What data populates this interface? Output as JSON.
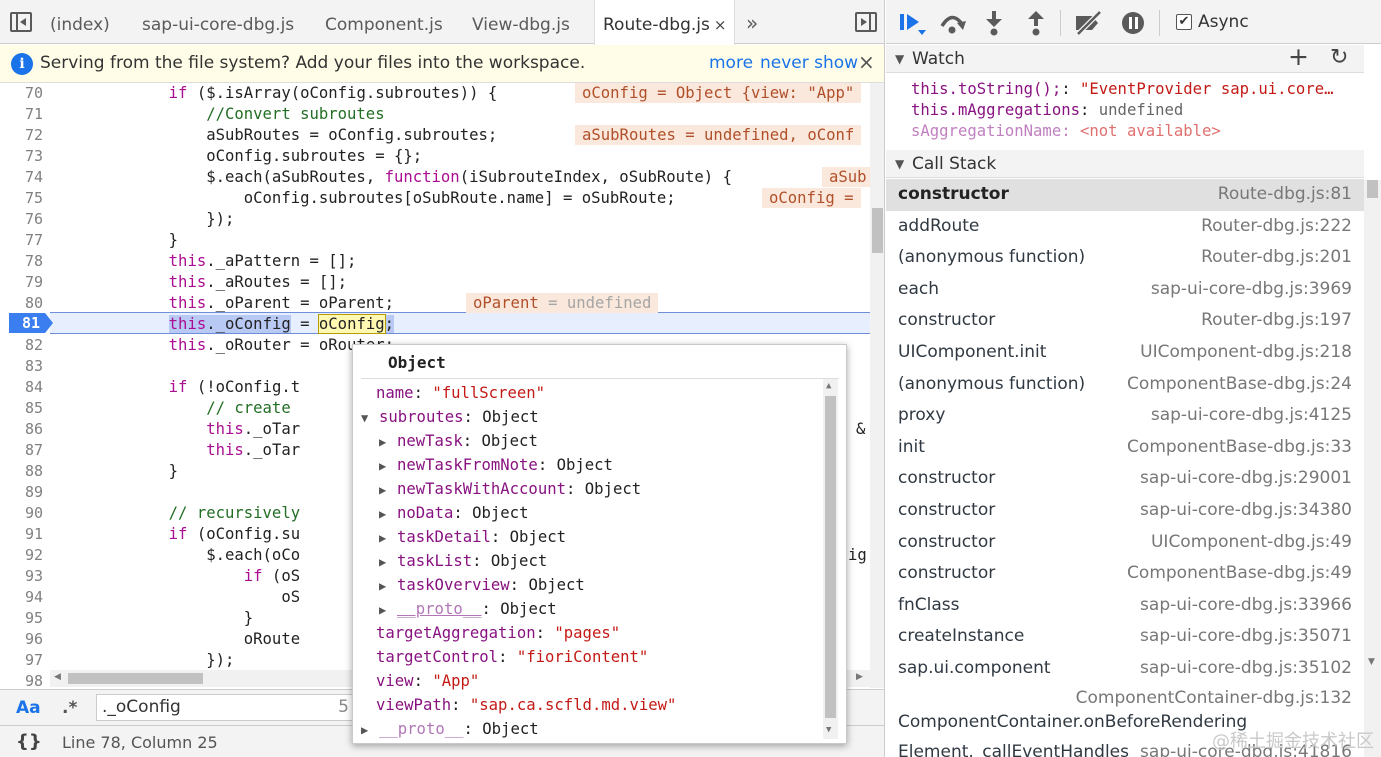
{
  "tabs": [
    {
      "label": "(index)"
    },
    {
      "label": "sap-ui-core-dbg.js"
    },
    {
      "label": "Component.js"
    },
    {
      "label": "View-dbg.js"
    },
    {
      "label": "Route-dbg.js",
      "close": "×"
    }
  ],
  "more_tabs": "»",
  "infobar": {
    "message": "Serving from the file system? Add your files into the workspace.",
    "more": "more",
    "never_show": "never show",
    "close": "×",
    "icon": "i"
  },
  "code": {
    "lines": [
      {
        "n": "70",
        "t": "            if ($.isArray(oConfig.subroutes)) {"
      },
      {
        "n": "71",
        "t": "                //Convert subroutes"
      },
      {
        "n": "72",
        "t": "                aSubRoutes = oConfig.subroutes;"
      },
      {
        "n": "73",
        "t": "                oConfig.subroutes = {};"
      },
      {
        "n": "74",
        "t": "                $.each(aSubRoutes, function(iSubrouteIndex, oSubRoute) {"
      },
      {
        "n": "75",
        "t": "                    oConfig.subroutes[oSubRoute.name] = oSubRoute;"
      },
      {
        "n": "76",
        "t": "                });"
      },
      {
        "n": "77",
        "t": "            }"
      },
      {
        "n": "78",
        "t": "            this._aPattern = [];"
      },
      {
        "n": "79",
        "t": "            this._aRoutes = [];"
      },
      {
        "n": "80",
        "t": "            this._oParent = oParent;"
      },
      {
        "n": "81",
        "t": ""
      },
      {
        "n": "82",
        "t": "            this._oRouter = oRouter;"
      },
      {
        "n": "83",
        "t": ""
      },
      {
        "n": "84",
        "t": "            if (!oConfig.t"
      },
      {
        "n": "85",
        "t": "                // create"
      },
      {
        "n": "86",
        "t": "                this._oTar"
      },
      {
        "n": "87",
        "t": "                this._oTar"
      },
      {
        "n": "88",
        "t": "            }"
      },
      {
        "n": "89",
        "t": ""
      },
      {
        "n": "90",
        "t": "            // recursively"
      },
      {
        "n": "91",
        "t": "            if (oConfig.su"
      },
      {
        "n": "92",
        "t": "                $.each(oCo"
      },
      {
        "n": "93",
        "t": "                    if (oS"
      },
      {
        "n": "94",
        "t": "                        oS"
      },
      {
        "n": "95",
        "t": "                    }"
      },
      {
        "n": "96",
        "t": "                    oRoute"
      },
      {
        "n": "97",
        "t": "                });"
      },
      {
        "n": "98",
        "t": ""
      }
    ],
    "line81": {
      "this": "this",
      "prop": "._oConfig",
      "eq": " = ",
      "val": "oConfig",
      "end": ";"
    },
    "annotations": {
      "a70": "oConfig = Object {view: \"App\"",
      "a72": "aSubRoutes = undefined, oConf",
      "a74": "aSub",
      "a75": "oConfig =",
      "a80k": "oParent",
      "a80v": " = undefined"
    },
    "right_edge_86": "&",
    "right_edge_92": "ig"
  },
  "search": {
    "case_label": "Aa",
    "regex_label": ".*",
    "value": "._oConfig",
    "count": "5"
  },
  "status": {
    "braces": "{}",
    "position": "Line 78, Column 25"
  },
  "popover": {
    "title": "Object",
    "rows": [
      {
        "k": "name",
        "v": "\"fullScreen\"",
        "type": "str",
        "exp": ""
      },
      {
        "k": "subroutes",
        "v": "Object",
        "type": "obj",
        "exp": "open"
      },
      {
        "k": "newTask",
        "v": "Object",
        "type": "obj",
        "exp": "closed",
        "indent": 1
      },
      {
        "k": "newTaskFromNote",
        "v": "Object",
        "type": "obj",
        "exp": "closed",
        "indent": 1
      },
      {
        "k": "newTaskWithAccount",
        "v": "Object",
        "type": "obj",
        "exp": "closed",
        "indent": 1
      },
      {
        "k": "noData",
        "v": "Object",
        "type": "obj",
        "exp": "closed",
        "indent": 1
      },
      {
        "k": "taskDetail",
        "v": "Object",
        "type": "obj",
        "exp": "closed",
        "indent": 1
      },
      {
        "k": "taskList",
        "v": "Object",
        "type": "obj",
        "exp": "closed",
        "indent": 1
      },
      {
        "k": "taskOverview",
        "v": "Object",
        "type": "obj",
        "exp": "closed",
        "indent": 1
      },
      {
        "k": "__proto__",
        "v": "Object",
        "type": "obj",
        "exp": "closed",
        "indent": 1
      },
      {
        "k": "targetAggregation",
        "v": "\"pages\"",
        "type": "str",
        "exp": ""
      },
      {
        "k": "targetControl",
        "v": "\"fioriContent\"",
        "type": "str",
        "exp": ""
      },
      {
        "k": "view",
        "v": "\"App\"",
        "type": "str",
        "exp": ""
      },
      {
        "k": "viewPath",
        "v": "\"sap.ca.scfld.md.view\"",
        "type": "str",
        "exp": ""
      },
      {
        "k": "__proto__",
        "v": "Object",
        "type": "obj",
        "exp": "closed"
      }
    ]
  },
  "toolbar": {
    "async_label": "Async",
    "async_checked": true
  },
  "watch": {
    "title": "Watch",
    "rows": [
      {
        "k": "this.toString();",
        "v": "\"EventProvider sap.ui.core…"
      },
      {
        "k": "this.mAggregations",
        "v": "undefined"
      },
      {
        "k": "sAggregationName",
        "v": "<not available>"
      }
    ]
  },
  "callstack": {
    "title": "Call Stack",
    "frames": [
      {
        "fn": "constructor",
        "file": "Route-dbg.js:81"
      },
      {
        "fn": "addRoute",
        "file": "Router-dbg.js:222"
      },
      {
        "fn": "(anonymous function)",
        "file": "Router-dbg.js:201"
      },
      {
        "fn": "each",
        "file": "sap-ui-core-dbg.js:3969"
      },
      {
        "fn": "constructor",
        "file": "Router-dbg.js:197"
      },
      {
        "fn": "UIComponent.init",
        "file": "UIComponent-dbg.js:218"
      },
      {
        "fn": "(anonymous function)",
        "file": "ComponentBase-dbg.js:24"
      },
      {
        "fn": "proxy",
        "file": "sap-ui-core-dbg.js:4125"
      },
      {
        "fn": "init",
        "file": "ComponentBase-dbg.js:33"
      },
      {
        "fn": "constructor",
        "file": "sap-ui-core-dbg.js:29001"
      },
      {
        "fn": "constructor",
        "file": "sap-ui-core-dbg.js:34380"
      },
      {
        "fn": "constructor",
        "file": "UIComponent-dbg.js:49"
      },
      {
        "fn": "constructor",
        "file": "ComponentBase-dbg.js:49"
      },
      {
        "fn": "fnClass",
        "file": "sap-ui-core-dbg.js:33966"
      },
      {
        "fn": "createInstance",
        "file": "sap-ui-core-dbg.js:35071"
      },
      {
        "fn": "sap.ui.component",
        "file": "sap-ui-core-dbg.js:35102"
      }
    ],
    "wrapped": {
      "file": "ComponentContainer-dbg.js:132",
      "fn": "ComponentContainer.onBeforeRendering"
    },
    "partial": {
      "fn": "Element._callEventHandles",
      "file": "sap-ui-core-dbg.js:41816"
    }
  },
  "watermark": "@稀土掘金技术社区",
  "colors": {
    "accent": "#1a73e8",
    "breakpoint": "#3a7ef0",
    "keyword": "#aa0d91",
    "string": "#c41a16",
    "comment": "#236e25"
  }
}
